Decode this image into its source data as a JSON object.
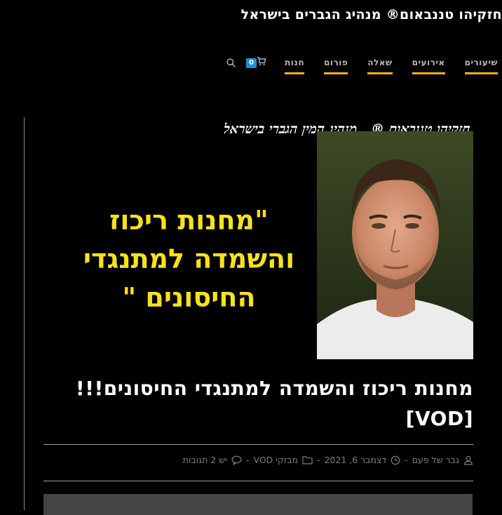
{
  "site": {
    "title": "חזקיהו טננבאום® מנהיג הגברים בישראל"
  },
  "nav": {
    "items": [
      {
        "label": "שיעורים"
      },
      {
        "label": "אירועים"
      },
      {
        "label": "שאלה"
      },
      {
        "label": "פורום"
      },
      {
        "label": "חנות"
      }
    ],
    "cart_count": "0",
    "accent_color": "#f2b407"
  },
  "hero": {
    "tagline": "חזקיהו טננבאום ® , מנהיג המין הגברי בישראל",
    "headline_lines": [
      "\"מחנות ריכוז",
      "והשמדה למתנגדי",
      "החיסונים \""
    ],
    "headline_color": "#f7e21b"
  },
  "post": {
    "title_line1": "מחנות ריכוז והשמדה למתנגדי החיסונים!!!",
    "title_line2": "[VOD]",
    "author": "גבר של פעם",
    "date": "דצמבר 6, 2021",
    "category": "מבזקי VOD",
    "comments": "יש 2 תגובות"
  }
}
